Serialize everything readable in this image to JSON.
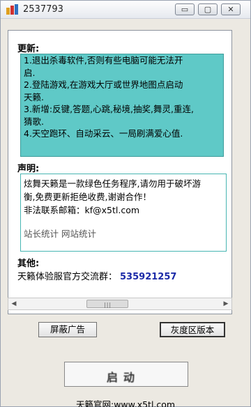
{
  "window": {
    "title": "2537793",
    "controls": {
      "minimize": "▭",
      "maximize": "▢",
      "close": "✕"
    }
  },
  "update": {
    "label": "更新:",
    "lines": [
      "1.退出杀毒软件,否则有些电脑可能无法开",
      "启.",
      "2.登陆游戏,在游戏大厅或世界地图点启动",
      "天籁.",
      "3.新增:反键,答题,心跳,秘境,抽奖,舞灵,重连,",
      "猜歌.",
      "4.天空跑环、自动采云、一局刷满爱心值."
    ]
  },
  "notice": {
    "label": "声明:",
    "lines": [
      "炫舞天籁是一款绿色任务程序,请勿用于破坏游",
      "衡,免费更新拒绝收费,谢谢合作！",
      "非法联系邮箱：kf@x5tl.com"
    ],
    "links": "站长统计  网站统计"
  },
  "other": {
    "label": "其他:",
    "qq_text": "天籁体验服官方交流群：",
    "qq_number": "535921257"
  },
  "buttons": {
    "block_ads": "屏蔽广告",
    "gray_version": "灰度区版本",
    "main": "启动"
  },
  "footer": "天籁官网:www.x5tl.com",
  "colors": {
    "update_bg": "#5fc9c7",
    "notice_border": "#47b5b2",
    "qq_number": "#1b2aa8"
  },
  "icons": {
    "app": "game-app-icon",
    "scroll_left": "chevron-left-icon",
    "scroll_right": "chevron-right-icon"
  }
}
